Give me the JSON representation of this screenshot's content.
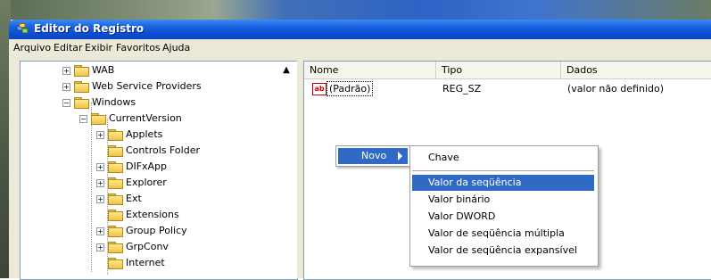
{
  "window": {
    "title": "Editor do Registro",
    "title_icon": "regedit-icon"
  },
  "menubar": {
    "items": [
      "Arquivo",
      "Editar",
      "Exibir",
      "Favoritos",
      "Ajuda"
    ]
  },
  "tree": {
    "items": [
      {
        "label": "WAB",
        "expander": "+"
      },
      {
        "label": "Web Service Providers",
        "expander": "+"
      },
      {
        "label": "Windows",
        "expander": "−"
      },
      {
        "label": "CurrentVersion",
        "expander": "−"
      },
      {
        "label": "Applets",
        "expander": "+"
      },
      {
        "label": "Controls Folder",
        "expander": ""
      },
      {
        "label": "DIFxApp",
        "expander": "+"
      },
      {
        "label": "Explorer",
        "expander": "+"
      },
      {
        "label": "Ext",
        "expander": "+"
      },
      {
        "label": "Extensions",
        "expander": ""
      },
      {
        "label": "Group Policy",
        "expander": "+"
      },
      {
        "label": "GrpConv",
        "expander": "+"
      },
      {
        "label": "Internet",
        "expander": ""
      }
    ]
  },
  "list": {
    "columns": [
      "Nome",
      "Tipo",
      "Dados"
    ],
    "rows": [
      {
        "name": "(Padrão)",
        "type": "REG_SZ",
        "data": "(valor não definido)",
        "icon": "string-value-icon"
      }
    ]
  },
  "context_menu": {
    "item": "Novo",
    "submenu": [
      "Chave",
      "Valor da seqüência",
      "Valor binário",
      "Valor DWORD",
      "Valor de seqüência múltipla",
      "Valor de seqüência expansível"
    ],
    "highlighted": "Valor da seqüência"
  },
  "colors": {
    "titlebar": "#0b4fd3",
    "highlight": "#316ac5",
    "menu_bg": "#ece9d8"
  }
}
